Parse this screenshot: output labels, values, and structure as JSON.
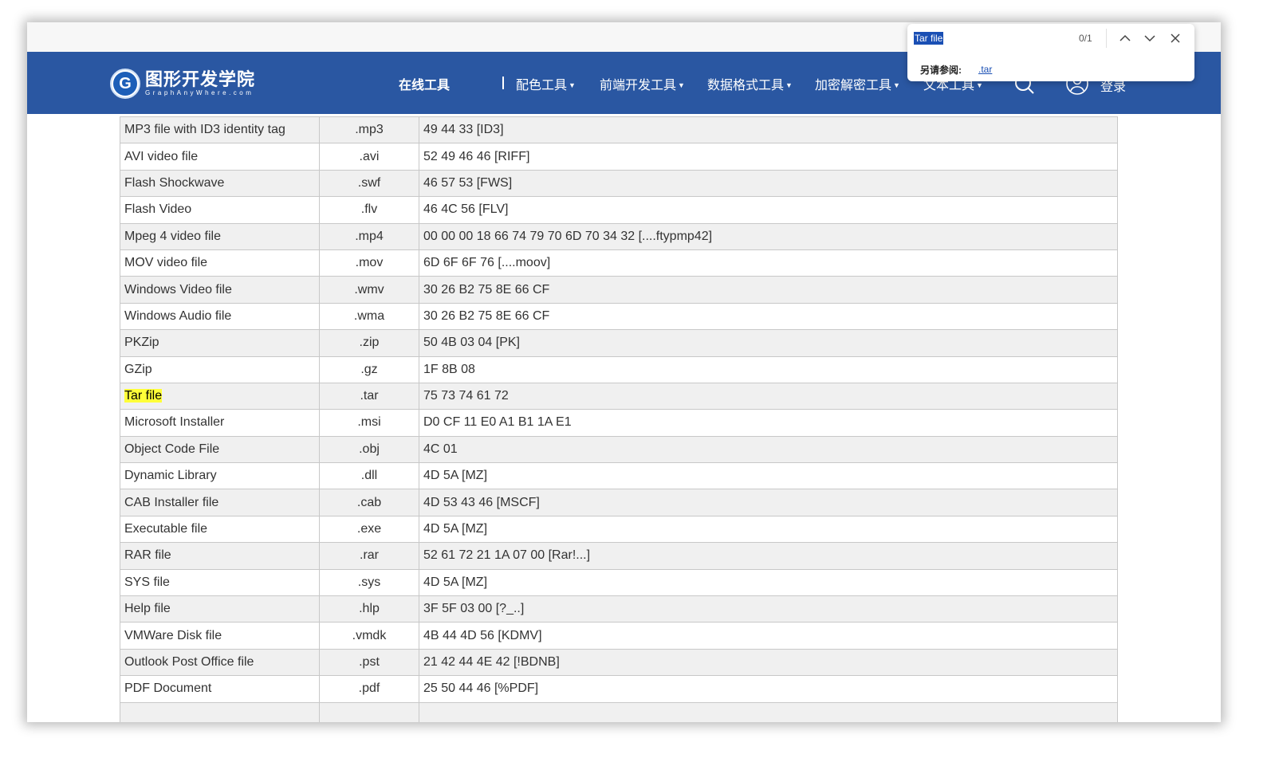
{
  "logo": {
    "title": "图形开发学院",
    "subtitle": "GraphAnyWhere.com"
  },
  "nav": {
    "online_tools": "在线工具",
    "items": [
      "配色工具",
      "前端开发工具",
      "数据格式工具",
      "加密解密工具",
      "文本工具"
    ],
    "login": "登录"
  },
  "table": {
    "rows": [
      [
        "MP3 file with ID3 identity tag",
        ".mp3",
        "49 44 33 [ID3]"
      ],
      [
        "AVI video file",
        ".avi",
        "52 49 46 46 [RIFF]"
      ],
      [
        "Flash Shockwave",
        ".swf",
        "46 57 53 [FWS]"
      ],
      [
        "Flash Video",
        ".flv",
        "46 4C 56 [FLV]"
      ],
      [
        "Mpeg 4 video file",
        ".mp4",
        "00 00 00 18 66 74 79 70 6D 70 34 32 [....ftypmp42]"
      ],
      [
        "MOV video file",
        ".mov",
        "6D 6F 6F 76 [....moov]"
      ],
      [
        "Windows Video file",
        ".wmv",
        "30 26 B2 75 8E 66 CF"
      ],
      [
        "Windows Audio file",
        ".wma",
        "30 26 B2 75 8E 66 CF"
      ],
      [
        "PKZip",
        ".zip",
        "50 4B 03 04 [PK]"
      ],
      [
        "GZip",
        ".gz",
        "1F 8B 08"
      ],
      [
        "Tar file",
        ".tar",
        "75 73 74 61 72"
      ],
      [
        "Microsoft Installer",
        ".msi",
        "D0 CF 11 E0 A1 B1 1A E1"
      ],
      [
        "Object Code File",
        ".obj",
        "4C 01"
      ],
      [
        "Dynamic Library",
        ".dll",
        "4D 5A [MZ]"
      ],
      [
        "CAB Installer file",
        ".cab",
        "4D 53 43 46 [MSCF]"
      ],
      [
        "Executable file",
        ".exe",
        "4D 5A [MZ]"
      ],
      [
        "RAR file",
        ".rar",
        "52 61 72 21 1A 07 00 [Rar!...]"
      ],
      [
        "SYS file",
        ".sys",
        "4D 5A [MZ]"
      ],
      [
        "Help file",
        ".hlp",
        "3F 5F 03 00 [?_..]"
      ],
      [
        "VMWare Disk file",
        ".vmdk",
        "4B 44 4D 56 [KDMV]"
      ],
      [
        "Outlook Post Office file",
        ".pst",
        "21 42 44 4E 42 [!BDNB]"
      ],
      [
        "PDF Document",
        ".pdf",
        "25 50 44 46 [%PDF]"
      ],
      [
        "",
        "",
        ""
      ]
    ],
    "highlight_row": 10
  },
  "find": {
    "query": "Tar file",
    "count": "0/1",
    "see_also_label": "另请参阅:",
    "see_also_link": ".tar"
  },
  "colors": {
    "navbar": "#2a57a2",
    "highlight": "#ffff38",
    "row_alt": "#f0f0f0",
    "link": "#1a4fb4"
  },
  "icons": {
    "search": "search-icon",
    "user": "user-icon",
    "find_prev": "chevron-up-icon",
    "find_next": "chevron-down-icon",
    "find_close": "close-icon"
  }
}
